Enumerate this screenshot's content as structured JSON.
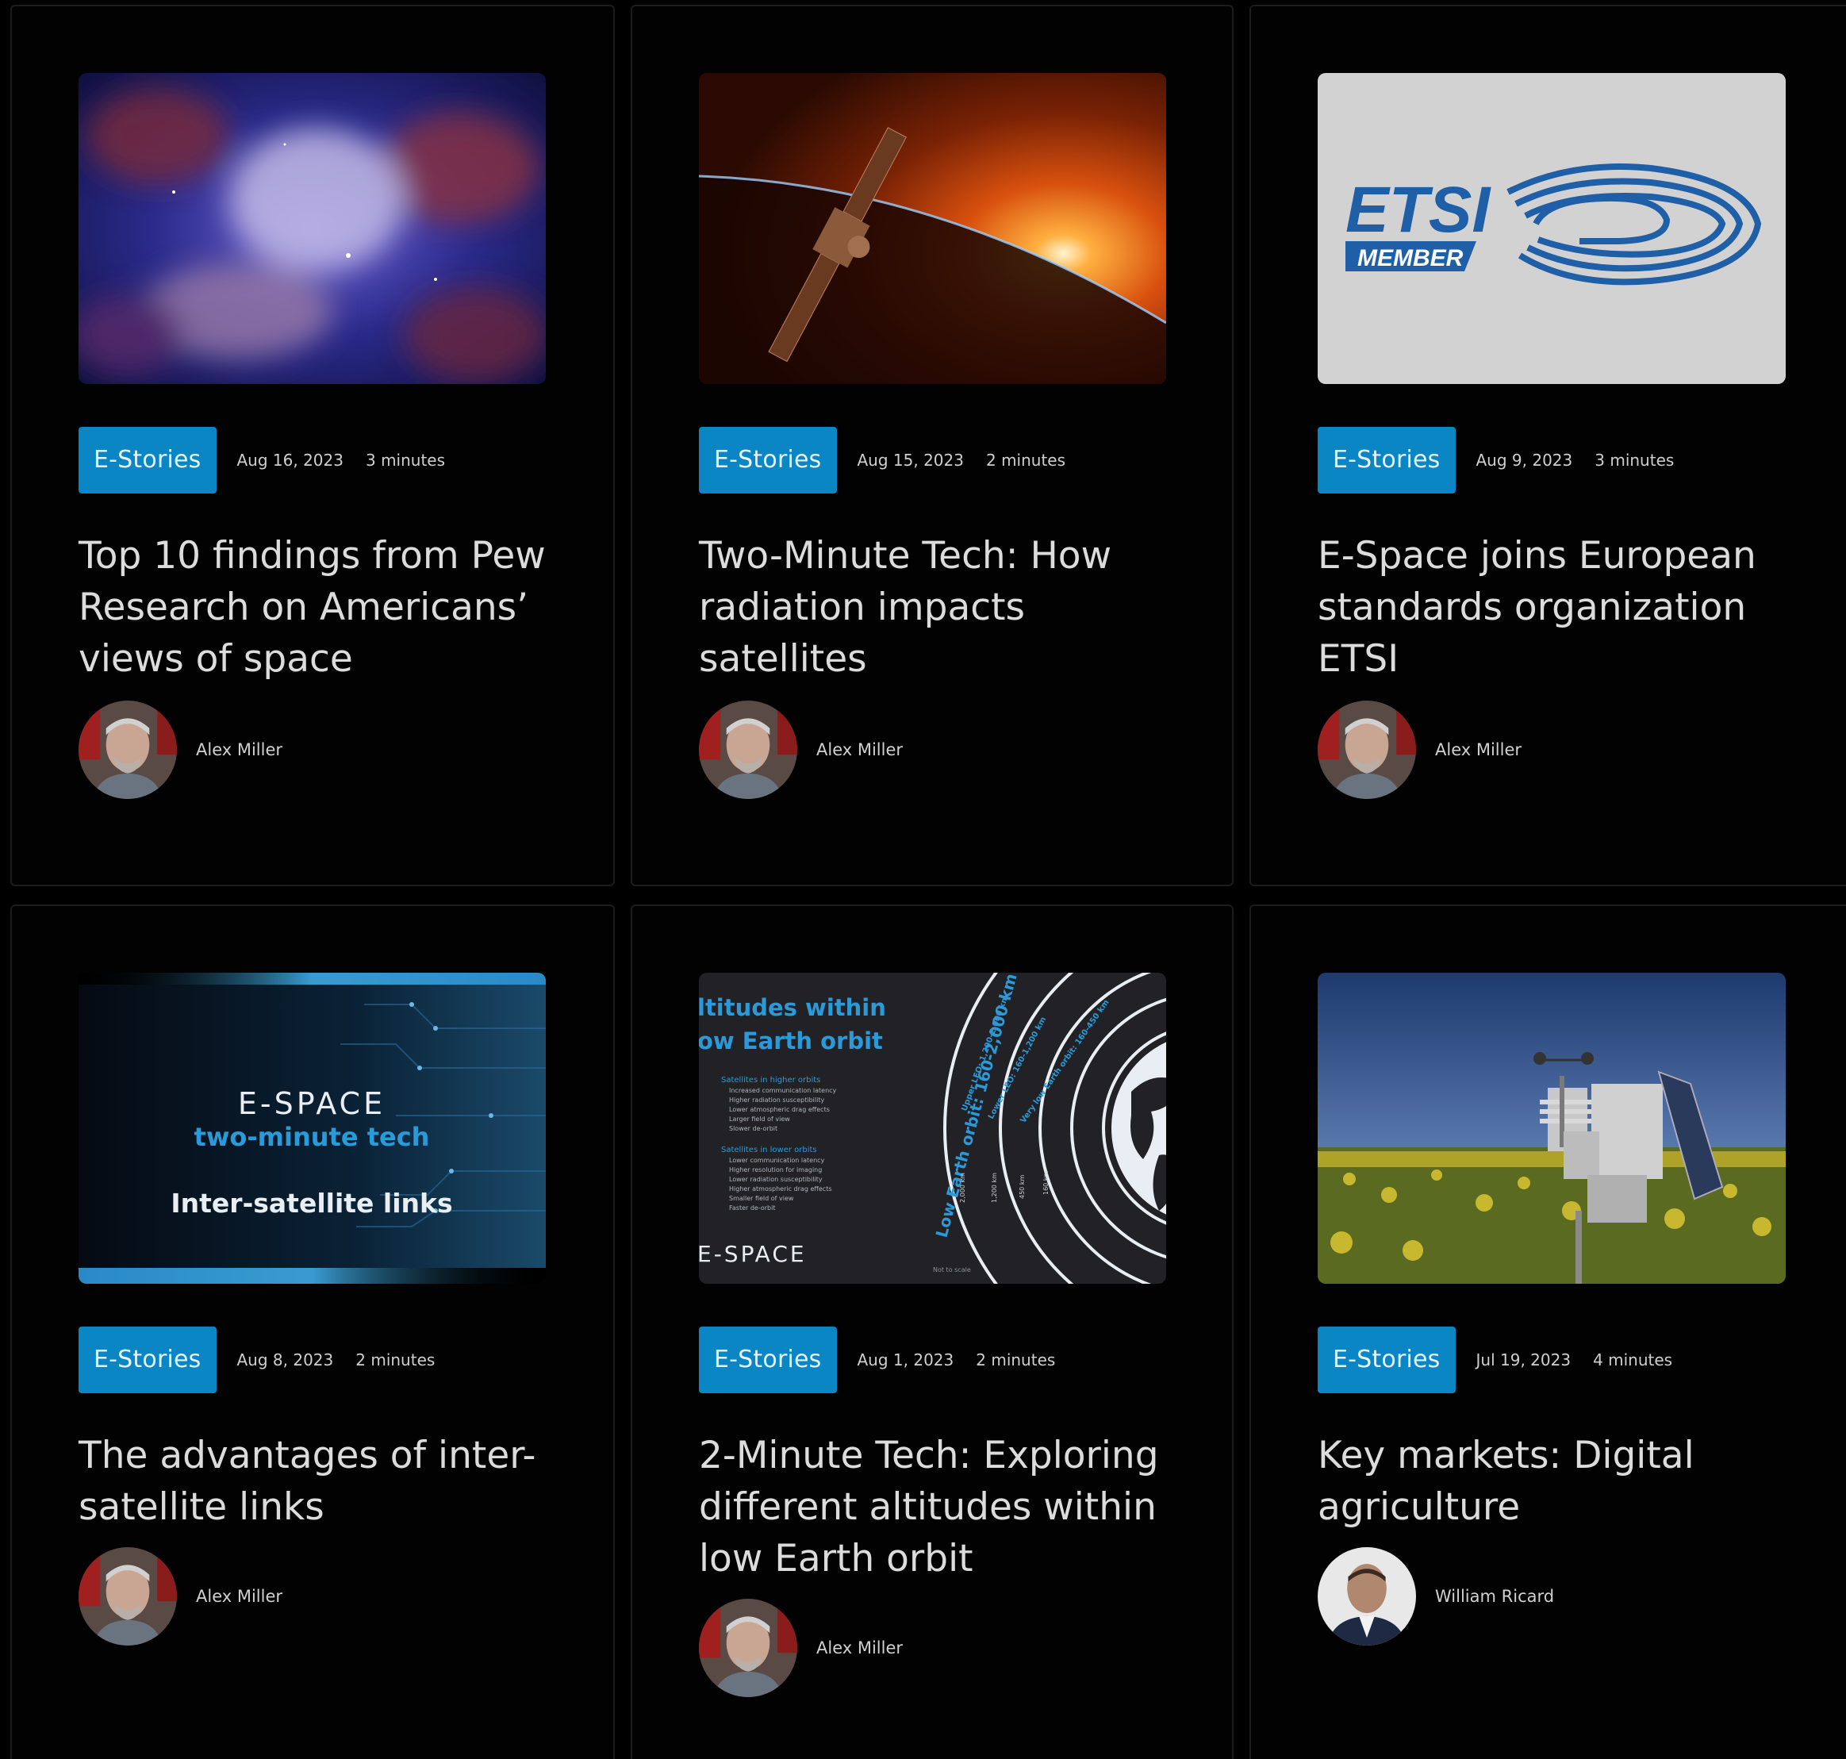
{
  "cards": [
    {
      "tag": "E-Stories",
      "date": "Aug 16, 2023",
      "read_time": "3 minutes",
      "title": "Top 10 findings from Pew Research on Americans’ views of space",
      "author": "Alex Miller",
      "image_icon": "nebula-image"
    },
    {
      "tag": "E-Stories",
      "date": "Aug 15, 2023",
      "read_time": "2 minutes",
      "title": "Two-Minute Tech: How radiation impacts satellites",
      "author": "Alex Miller",
      "image_icon": "satellite-sunrise-image"
    },
    {
      "tag": "E-Stories",
      "date": "Aug 9, 2023",
      "read_time": "3 minutes",
      "title": "E-Space joins European standards organization ETSI",
      "author": "Alex Miller",
      "image_icon": "etsi-member-logo",
      "image_text": {
        "logo": "ETSI",
        "badge": "MEMBER"
      }
    },
    {
      "tag": "E-Stories",
      "date": "Aug 8, 2023",
      "read_time": "2 minutes",
      "title": "The advantages of inter-satellite links",
      "author": "Alex Miller",
      "image_icon": "inter-satellite-links-banner",
      "image_text": {
        "brand": "E-SPACE",
        "series": "two-minute tech",
        "topic": "Inter-satellite links"
      }
    },
    {
      "tag": "E-Stories",
      "date": "Aug 1, 2023",
      "read_time": "2 minutes",
      "title": "2-Minute Tech: Exploring different altitudes within low Earth orbit",
      "author": "Alex Miller",
      "image_icon": "leo-altitudes-infographic",
      "image_text": {
        "heading_1": "ltitudes within",
        "heading_2": "ow Earth orbit",
        "higher_head": "Satellites in higher orbits",
        "higher": [
          "Increased communication latency",
          "Higher radiation susceptibility",
          "Lower atmospheric drag effects",
          "Larger field of view",
          "Slower de-orbit"
        ],
        "lower_head": "Satellites in lower orbits",
        "lower": [
          "Lower communication latency",
          "Higher resolution for imaging",
          "Lower radiation susceptibility",
          "Higher atmospheric drag effects",
          "Smaller field of view",
          "Faster de-orbit"
        ],
        "brand": "E-SPACE",
        "note": "Not to scale",
        "arc_1": "Low Earth orbit: 160-2,000 km",
        "arc_2": "Upper LEO: 1,200-2,000 km",
        "arc_3": "Lower LEO: 160-1,200 km",
        "arc_4": "Very low Earth orbit: 160-450 km",
        "km_1": "2,000 km",
        "km_2": "1,200 km",
        "km_3": "450 km",
        "km_4": "160 km"
      }
    },
    {
      "tag": "E-Stories",
      "date": "Jul 19, 2023",
      "read_time": "4 minutes",
      "title": "Key markets: Digital agriculture",
      "author": "William Ricard",
      "image_icon": "weather-station-field-image"
    }
  ],
  "colors": {
    "tag_bg": "#0a86c4",
    "background": "#000000"
  }
}
